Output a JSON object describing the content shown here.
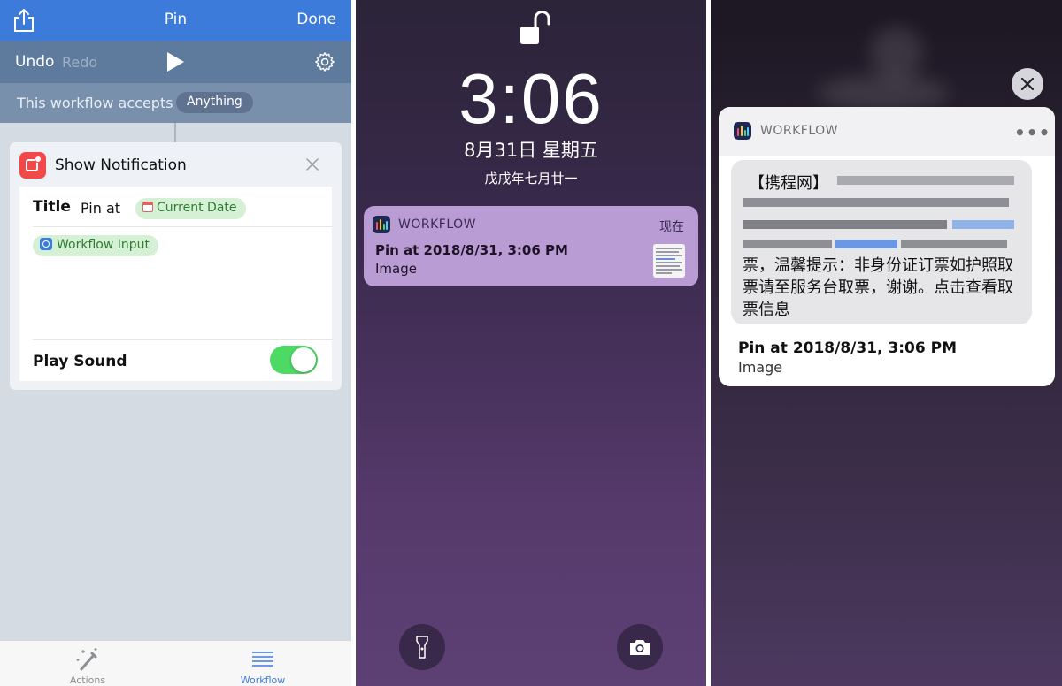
{
  "colors": {
    "workflow_blue": "#3d7bdb",
    "toggle_green": "#4cd964",
    "notification_lock_bg": "#c4a6e0",
    "app_tile_red": "#f24848"
  },
  "editor": {
    "nav": {
      "title": "Pin",
      "done_label": "Done",
      "share_icon": "share-icon"
    },
    "toolbar": {
      "undo_label": "Undo",
      "redo_label": "Redo",
      "run_icon": "play-icon",
      "settings_icon": "gear-icon"
    },
    "accepts": {
      "label": "This workflow accepts",
      "value": "Anything"
    },
    "action": {
      "title": "Show Notification",
      "title_field": {
        "label": "Title",
        "text": "Pin at",
        "variable": "Current Date"
      },
      "body_variable": "Workflow Input",
      "sound": {
        "label": "Play Sound",
        "enabled": true
      }
    },
    "tabs": [
      {
        "label": "Actions",
        "icon": "magic-wand-icon",
        "selected": false
      },
      {
        "label": "Workflow",
        "icon": "list-icon",
        "selected": true
      }
    ]
  },
  "lockscreen": {
    "time": "3:06",
    "date": "8月31日 星期五",
    "lunar_date": "戊戌年七月廿一",
    "notification": {
      "app": "WORKFLOW",
      "when": "现在",
      "title": "Pin at 2018/8/31, 3:06 PM",
      "body": "Image"
    },
    "buttons": [
      "flashlight-icon",
      "camera-icon"
    ]
  },
  "expanded": {
    "notification": {
      "app": "WORKFLOW",
      "more_label": "•••",
      "image_text_head": "【携程网】",
      "image_text_tail": "票，温馨提示：非身份证订票如护照取票请至服务台取票，谢谢。点击查看取票信息",
      "title": "Pin at 2018/8/31, 3:06 PM",
      "body": "Image"
    },
    "dismiss_icon": "close-icon"
  }
}
